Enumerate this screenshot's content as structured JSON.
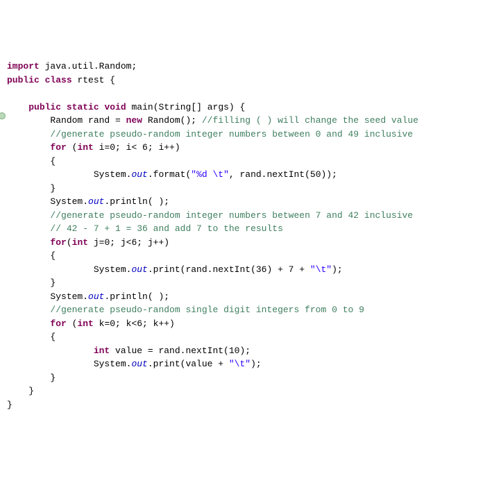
{
  "code": {
    "l1_import": "import",
    "l1_pkg": "java.util.Random;",
    "l2_public": "public",
    "l2_class": "class",
    "l2_name": "rtest {",
    "l4_public": "public",
    "l4_static": "static",
    "l4_void": "void",
    "l4_main": "main(String[] args) {",
    "l5a": "Random rand = ",
    "l5_new": "new",
    "l5b": " Random(); ",
    "l5_cm": "//filling ( ) will change the seed value",
    "l6_cm": "//generate pseudo-random integer numbers between 0 and 49 inclusive",
    "l7_for": "for",
    "l7_rest": " (",
    "l7_int": "int",
    "l7_body": " i=0; i< 6; i++)",
    "l8": "{",
    "l9a": "System.",
    "l9_out": "out",
    "l9b": ".format(",
    "l9_str": "\"%d \\t\"",
    "l9c": ", rand.nextInt(50));",
    "l10": "}",
    "l11a": "System.",
    "l11_out": "out",
    "l11b": ".println( );",
    "l12_cm": "//generate pseudo-random integer numbers between 7 and 42 inclusive",
    "l13_cm": "// 42 - 7 + 1 = 36 and add 7 to the results",
    "l14_for": "for",
    "l14a": "(",
    "l14_int": "int",
    "l14b": " j=0; j<6; j++)",
    "l15": "{",
    "l16a": "System.",
    "l16_out": "out",
    "l16b": ".print(rand.nextInt(36) + 7 + ",
    "l16_str": "\"\\t\"",
    "l16c": ");",
    "l17": "}",
    "l18a": "System.",
    "l18_out": "out",
    "l18b": ".println( );",
    "l19_cm": "//generate pseudo-random single digit integers from 0 to 9",
    "l20_for": "for",
    "l20a": " (",
    "l20_int": "int",
    "l20b": " k=0; k<6; k++)",
    "l21": "{",
    "l22_int": "int",
    "l22a": " value = rand.nextInt(10);",
    "l23a": "System.",
    "l23_out": "out",
    "l23b": ".print(value + ",
    "l23_str": "\"\\t\"",
    "l23c": ");",
    "l24": "}",
    "l25": "}",
    "l26": "}"
  }
}
